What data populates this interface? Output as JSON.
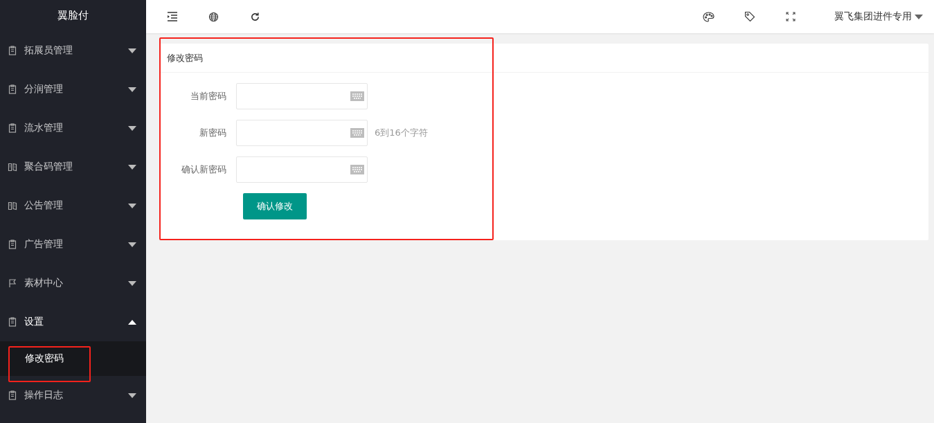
{
  "logo": "翼脸付",
  "sidebar": {
    "items": [
      {
        "label": "拓展员管理",
        "kind": "clipboard",
        "expanded": false
      },
      {
        "label": "分润管理",
        "kind": "clipboard",
        "expanded": false
      },
      {
        "label": "流水管理",
        "kind": "clipboard",
        "expanded": false
      },
      {
        "label": "聚合码管理",
        "kind": "book",
        "expanded": false
      },
      {
        "label": "公告管理",
        "kind": "book",
        "expanded": false
      },
      {
        "label": "广告管理",
        "kind": "clipboard",
        "expanded": false
      },
      {
        "label": "素材中心",
        "kind": "flag",
        "expanded": false
      },
      {
        "label": "设置",
        "kind": "clipboard",
        "expanded": true,
        "children": [
          {
            "label": "修改密码",
            "selected": true
          }
        ]
      },
      {
        "label": "操作日志",
        "kind": "clipboard",
        "expanded": false
      }
    ]
  },
  "header": {
    "user": "翼飞集团进件专用"
  },
  "card": {
    "title": "修改密码",
    "fields": [
      {
        "label": "当前密码"
      },
      {
        "label": "新密码",
        "hint": "6到16个字符"
      },
      {
        "label": "确认新密码"
      }
    ],
    "submit": "确认修改"
  }
}
